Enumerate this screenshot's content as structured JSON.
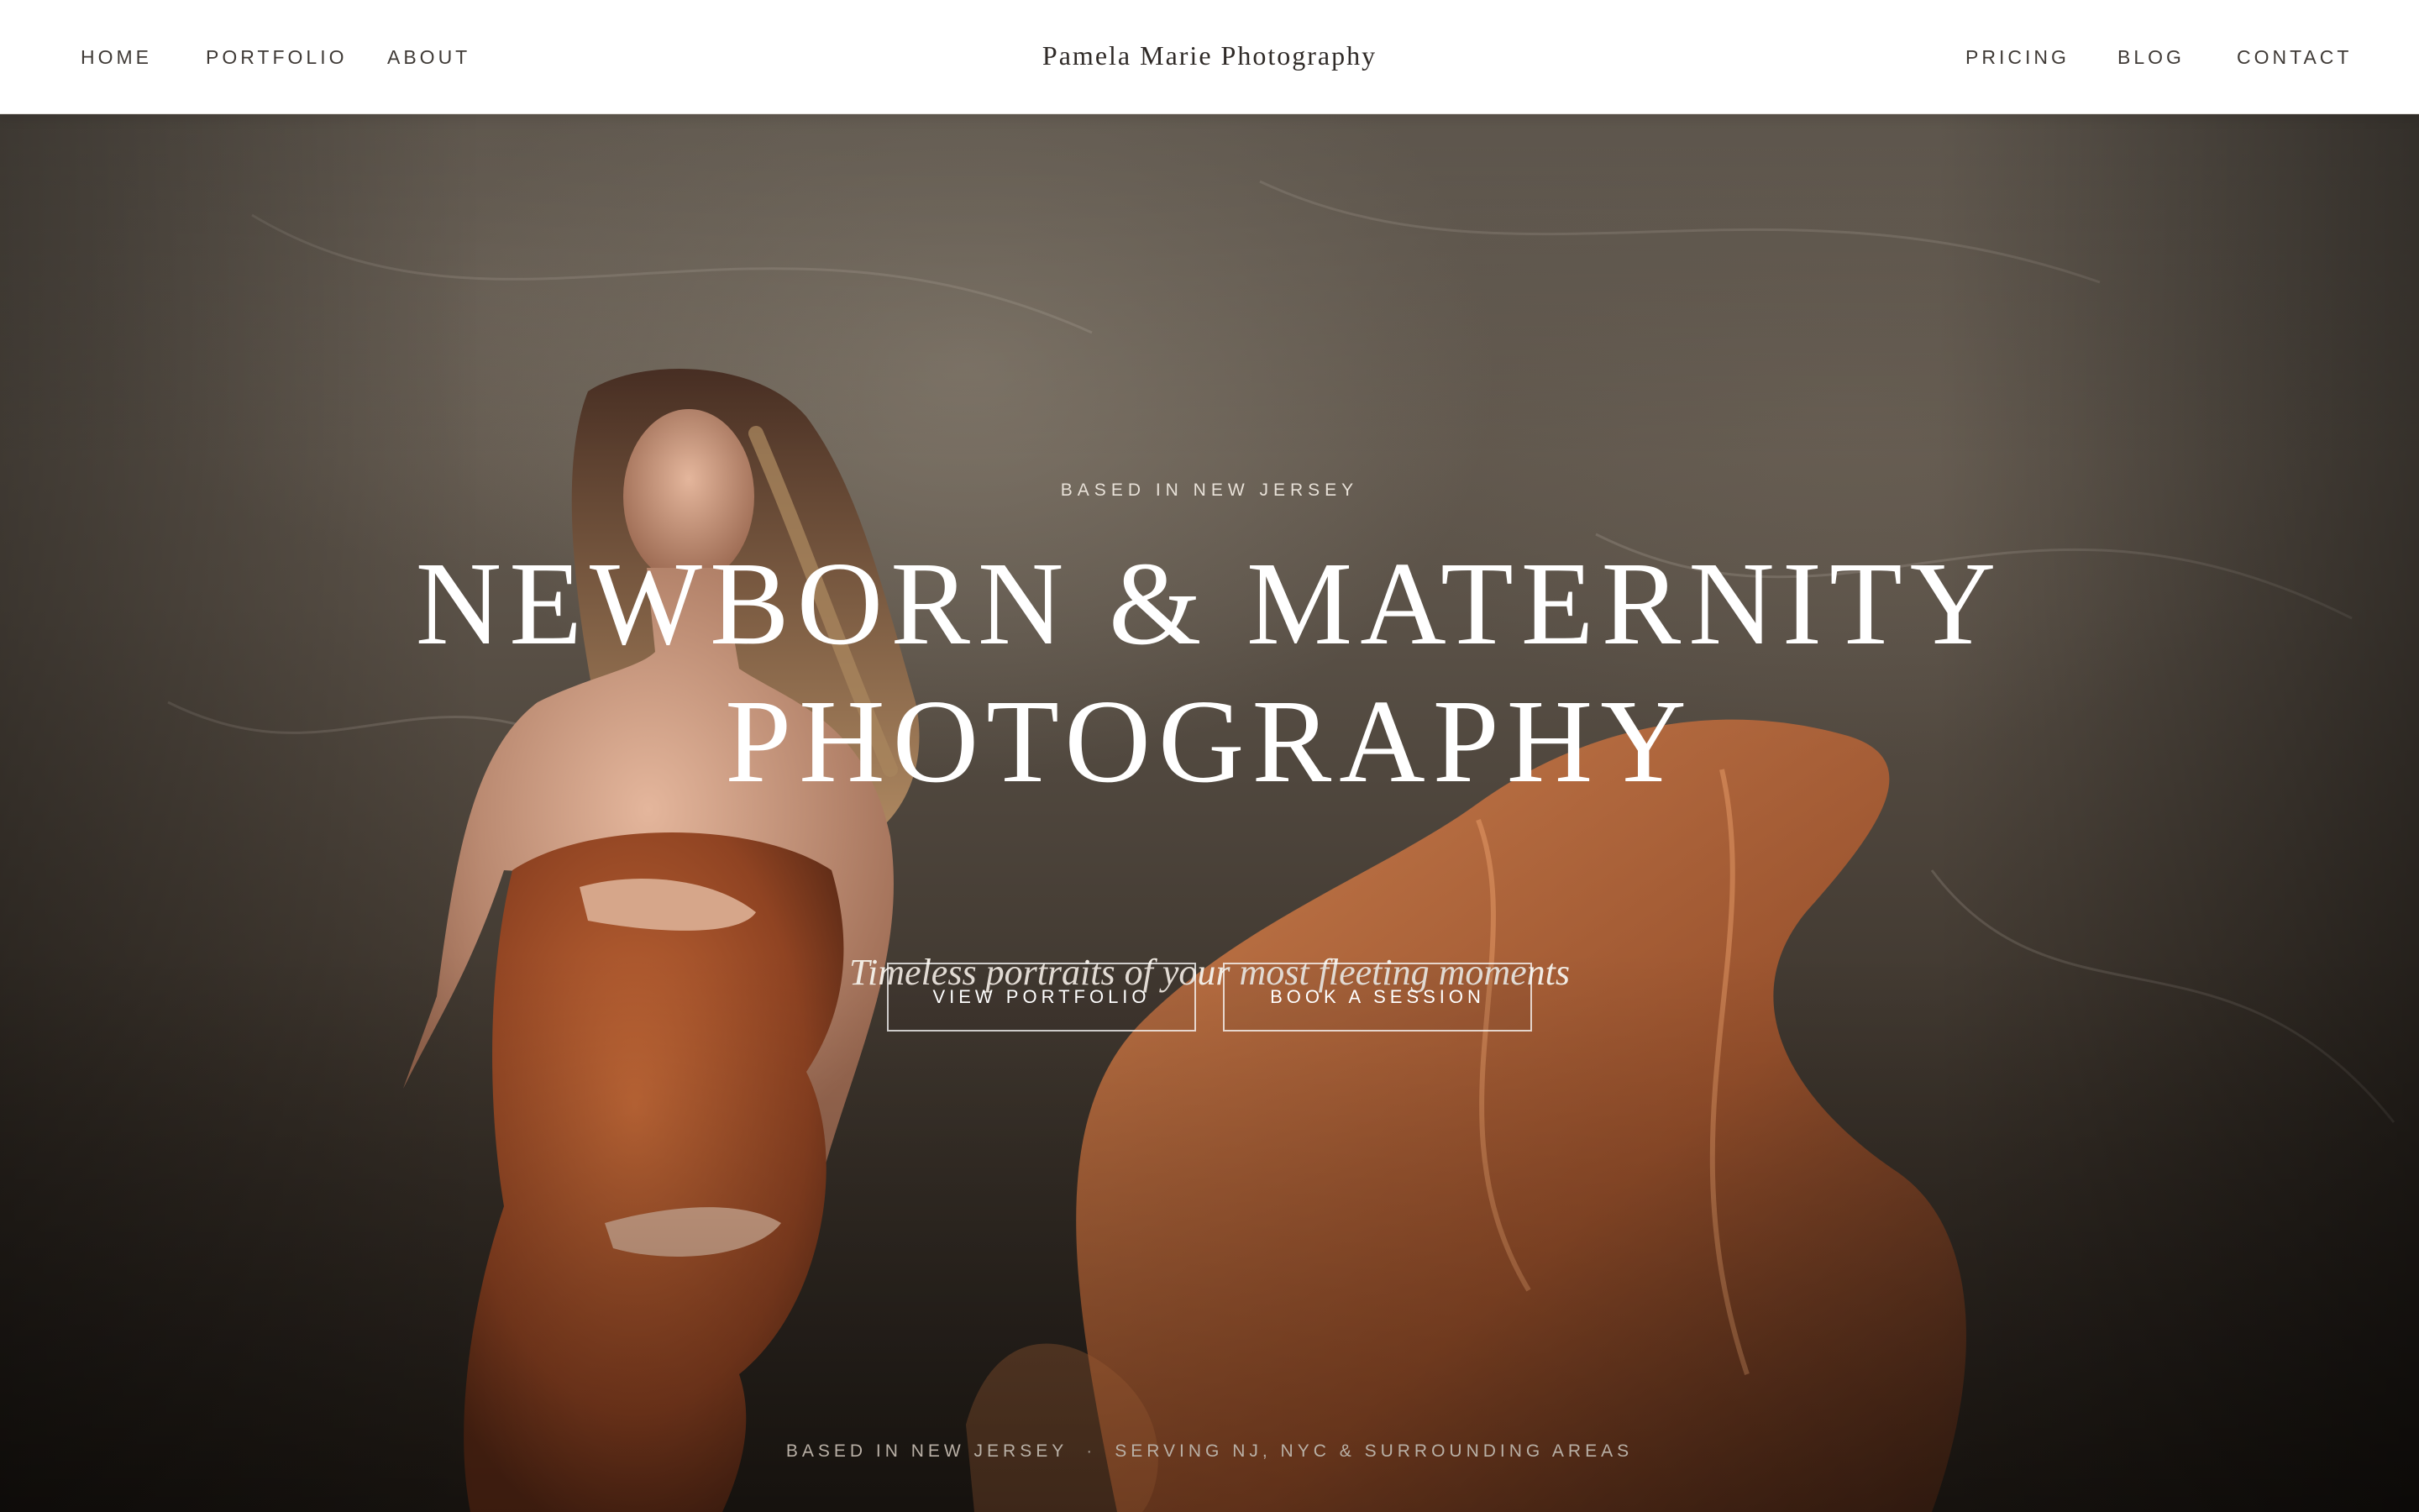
{
  "header": {
    "brand": "Pamela Marie Photography",
    "nav_left": [
      "HOME",
      "PORTFOLIO",
      "ABOUT"
    ],
    "nav_right": [
      "PRICING",
      "BLOG",
      "CONTACT"
    ]
  },
  "hero": {
    "eyebrow": "BASED IN NEW JERSEY",
    "headline_line1": "NEWBORN & MATERNITY",
    "headline_line2": "PHOTOGRAPHY",
    "tagline": "Timeless portraits of your most fleeting moments",
    "cta_primary": "VIEW PORTFOLIO",
    "cta_secondary": "BOOK A SESSION",
    "footer_left": "BASED IN NEW JERSEY",
    "footer_separator": "·",
    "footer_right": "SERVING NJ, NYC & SURROUNDING AREAS"
  },
  "colors": {
    "header_bg": "#ffffff",
    "nav_text": "#3f3a36",
    "hero_text": "#ffffff",
    "backdrop": "#5b5248",
    "fabric": "#b8602f"
  }
}
